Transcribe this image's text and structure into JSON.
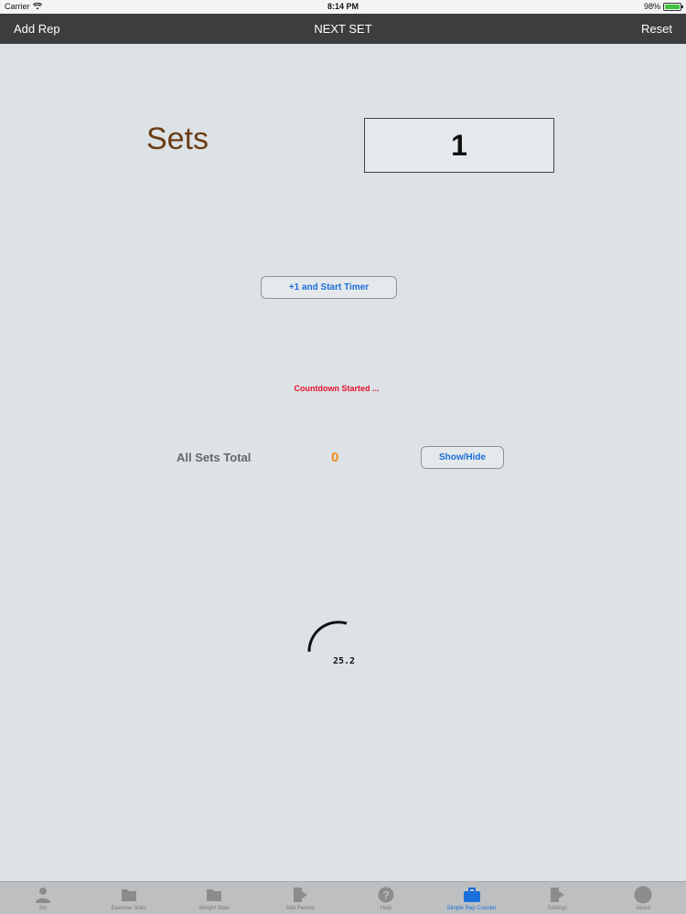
{
  "status_bar": {
    "carrier": "Carrier",
    "time": "8:14 PM",
    "battery": "98%",
    "battery_level": 0.98
  },
  "nav": {
    "left_label": "Add Rep",
    "title": "NEXT SET",
    "right_label": "Reset"
  },
  "sets": {
    "label": "Sets",
    "value": "1"
  },
  "start_button_label": "+1 and Start Timer",
  "countdown_text": "Countdown Started ...",
  "totals": {
    "label": "All Sets Total",
    "value": "0",
    "toggle_label": "Show/Hide"
  },
  "timer": {
    "value": "25.2"
  },
  "colors": {
    "accent": "#1a6fd8",
    "sets_label": "#6b3d14",
    "countdown": "#e8112d",
    "total_value": "#f08a1c"
  },
  "tabs": [
    {
      "label": "Sin",
      "icon": "person-icon"
    },
    {
      "label": "Exercise Stats",
      "icon": "folder-icon"
    },
    {
      "label": "Weight Stats",
      "icon": "folder-icon"
    },
    {
      "label": "Add Person",
      "icon": "add-document-icon"
    },
    {
      "label": "Help",
      "icon": "help-icon"
    },
    {
      "label": "Simple Rep Counter",
      "icon": "briefcase-icon",
      "active": true
    },
    {
      "label": "Settings",
      "icon": "settings-document-icon"
    },
    {
      "label": "About",
      "icon": "circle-icon"
    }
  ]
}
